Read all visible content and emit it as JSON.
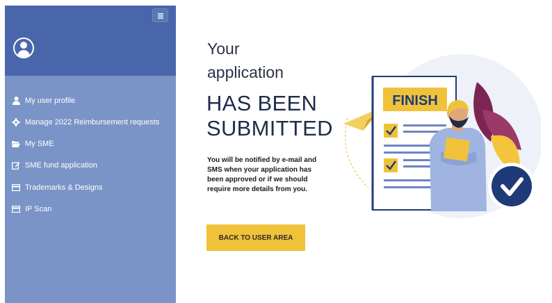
{
  "sidebar": {
    "menu_toggle_icon": "hamburger-icon",
    "avatar_icon": "user-avatar-icon",
    "items": [
      {
        "label": "My user profile",
        "icon": "user-icon"
      },
      {
        "label": "Manage 2022 Reimbursement requests",
        "icon": "gear-icon"
      },
      {
        "label": "My SME",
        "icon": "folder-open-icon"
      },
      {
        "label": "SME fund application",
        "icon": "edit-icon"
      },
      {
        "label": "Trademarks & Designs",
        "icon": "card-icon"
      },
      {
        "label": "IP Scan",
        "icon": "card-icon"
      }
    ]
  },
  "main": {
    "title_line1": "Your",
    "title_line2": "application",
    "headline_line1": "HAS BEEN",
    "headline_line2": "SUBMITTED",
    "notice": "You will be notified by e-mail and SMS when your application has been approved or if we should require more details from you.",
    "back_button": "BACK TO USER AREA"
  },
  "illustration": {
    "sign_label": "FINISH"
  },
  "colors": {
    "sidebar_header": "#4a66aa",
    "sidebar_body": "#7b94c7",
    "accent_yellow": "#f0c23a",
    "navy": "#1f3a78",
    "headline": "#1f2c4a"
  }
}
